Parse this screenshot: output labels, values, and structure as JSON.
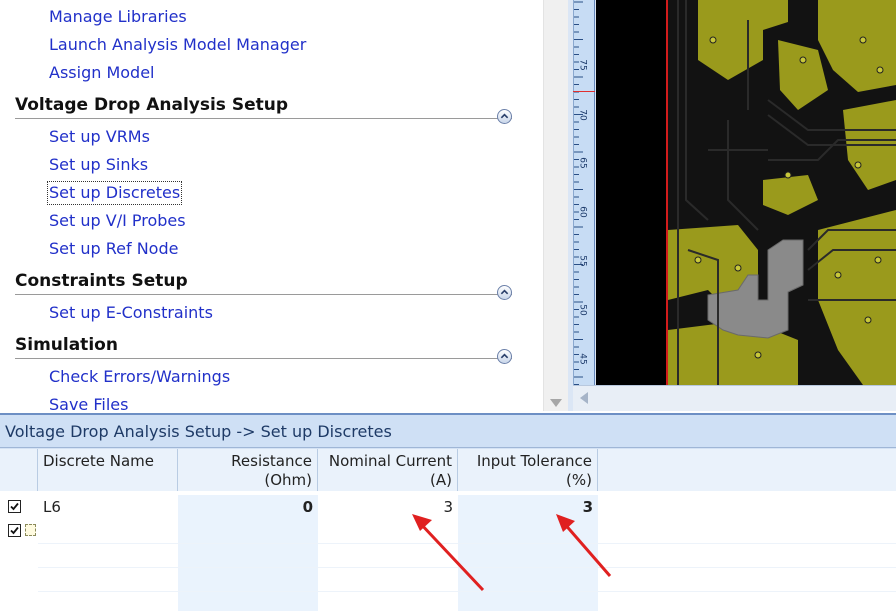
{
  "workflow": {
    "top_links": [
      "Manage Libraries",
      "Launch Analysis Model Manager",
      "Assign Model"
    ],
    "sections": [
      {
        "title": "Voltage Drop Analysis Setup",
        "links": [
          "Set up VRMs",
          "Set up Sinks",
          "Set up Discretes",
          "Set up V/I Probes",
          "Set up Ref Node"
        ]
      },
      {
        "title": "Constraints Setup",
        "links": [
          "Set up E-Constraints"
        ]
      },
      {
        "title": "Simulation",
        "links": [
          "Check Errors/Warnings",
          "Save Files"
        ]
      }
    ],
    "focused_link": "Set up Discretes",
    "collapse_icon": "chevron-up-icon"
  },
  "pcb_view": {
    "ruler_labels": [
      "75",
      "70",
      "65",
      "60",
      "55",
      "50",
      "45"
    ],
    "board_color": "#9a9a1c",
    "trace_color": "#121212"
  },
  "grid": {
    "title": "Voltage Drop Analysis Setup -> Set up Discretes",
    "columns": [
      {
        "label": "Discrete Name"
      },
      {
        "label": "Resistance (Ohm)"
      },
      {
        "label": "Nominal Current\n(A)"
      },
      {
        "label": "Input Tolerance\n(%)"
      }
    ],
    "rows": [
      {
        "checked": true,
        "name": "L6",
        "resistance": "0",
        "nominal_current": "3",
        "input_tolerance": "3"
      }
    ],
    "new_row": {
      "checked": true
    }
  },
  "annotations": {
    "arrow_color": "#e02020",
    "arrows": [
      "pointing-to-nominal-current",
      "pointing-to-input-tolerance"
    ]
  }
}
